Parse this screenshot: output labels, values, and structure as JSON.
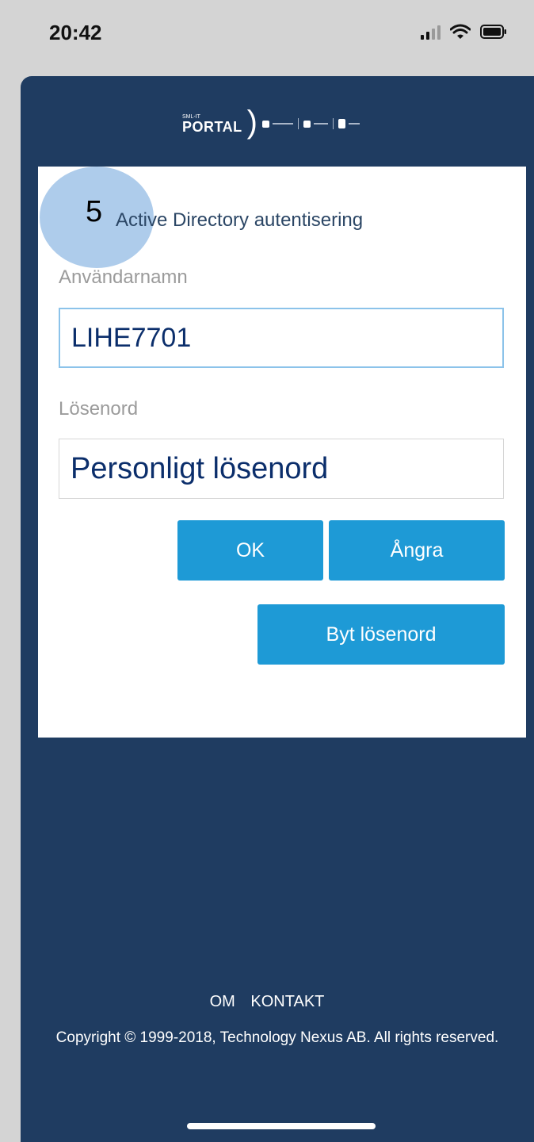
{
  "status_bar": {
    "time": "20:42",
    "icons": [
      "cellular-signal-icon",
      "wifi-icon",
      "battery-icon"
    ]
  },
  "logo": {
    "small_text": "SML-IT",
    "main_text": "PORTAL",
    "bracket": ")"
  },
  "login": {
    "step_number": "5",
    "title": "Active Directory autentisering",
    "username_label": "Användarnamn",
    "username_value": "LIHE7701",
    "password_label": "Lösenord",
    "password_value": "Personligt lösenord",
    "ok_label": "OK",
    "cancel_label": "Ångra",
    "change_password_label": "Byt lösenord"
  },
  "footer": {
    "about_link": "OM",
    "contact_link": "KONTAKT",
    "copyright": "Copyright © 1999-2018, Technology Nexus AB. All rights reserved."
  },
  "colors": {
    "background_dark": "#1f3c61",
    "accent": "#1e9ad6",
    "status_bar": "#d4d4d4"
  }
}
